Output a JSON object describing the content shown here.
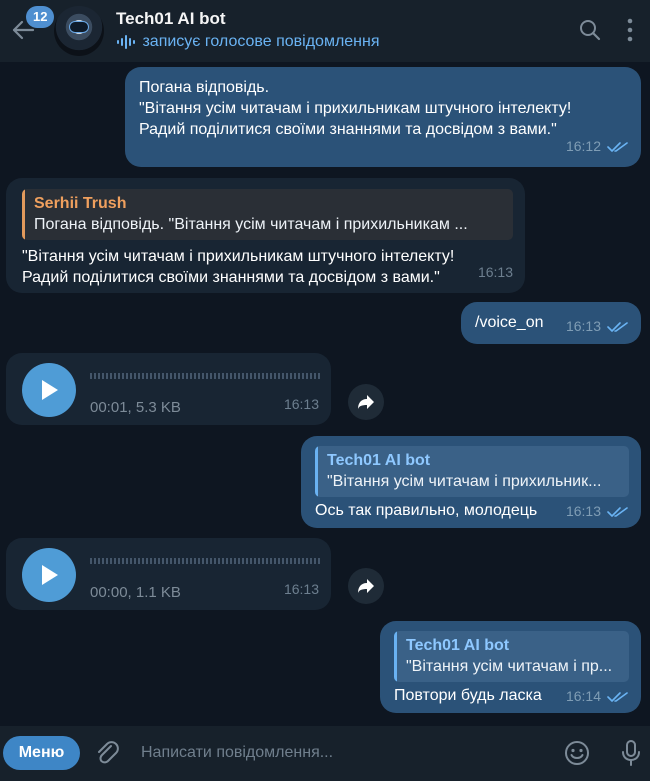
{
  "header": {
    "back_icon": "arrow-left-icon",
    "unread_count": "12",
    "title": "Tech01 AI bot",
    "status": "записує голосове повідомлення",
    "status_icon": "recording-voice-icon",
    "search_icon": "search-icon",
    "more_icon": "more-vertical-icon"
  },
  "messages": [
    {
      "direction": "outgoing",
      "text": "Погана відповідь.\n\"Вітання усім читачам і прихильникам штучного інтелекту!\nРадий поділитися своїми знаннями та досвідом з вами.\"",
      "time": "16:12",
      "read": true
    },
    {
      "direction": "incoming",
      "reply": {
        "author": "Serhii Trush",
        "text": "Погана відповідь. \"Вітання усім читачам і прихильникам ..."
      },
      "text": "\"Вітання усім читачам і прихильникам штучного інтелекту!\nРадий поділитися своїми знаннями та досвідом з вами.\"",
      "time": "16:13"
    },
    {
      "direction": "outgoing",
      "text": "/voice_on",
      "time": "16:13",
      "read": true
    },
    {
      "direction": "incoming",
      "type": "voice",
      "info": "00:01, 5.3 KB",
      "time": "16:13"
    },
    {
      "direction": "outgoing",
      "reply": {
        "author": "Tech01 AI bot",
        "text": "\"Вітання усім читачам і прихильник..."
      },
      "text": "Ось так правильно, молодець",
      "time": "16:13",
      "read": true
    },
    {
      "direction": "incoming",
      "type": "voice",
      "info": "00:00, 1.1 KB",
      "time": "16:13"
    },
    {
      "direction": "outgoing",
      "reply": {
        "author": "Tech01 AI bot",
        "text": "\"Вітання усім читачам і пр..."
      },
      "text": "Повтори будь ласка",
      "time": "16:14",
      "read": true
    }
  ],
  "composer": {
    "menu_label": "Меню",
    "placeholder": "Написати повідомлення...",
    "attach_icon": "paperclip-icon",
    "emoji_icon": "emoji-icon",
    "mic_icon": "microphone-icon"
  },
  "colors": {
    "background": "#0e1621",
    "header": "#17212b",
    "outgoing_bubble": "#2b5278",
    "incoming_bubble": "#182533",
    "accent": "#6ab3f3",
    "menu_button": "#3e86c6",
    "reply_author_incoming": "#f0a05e"
  }
}
